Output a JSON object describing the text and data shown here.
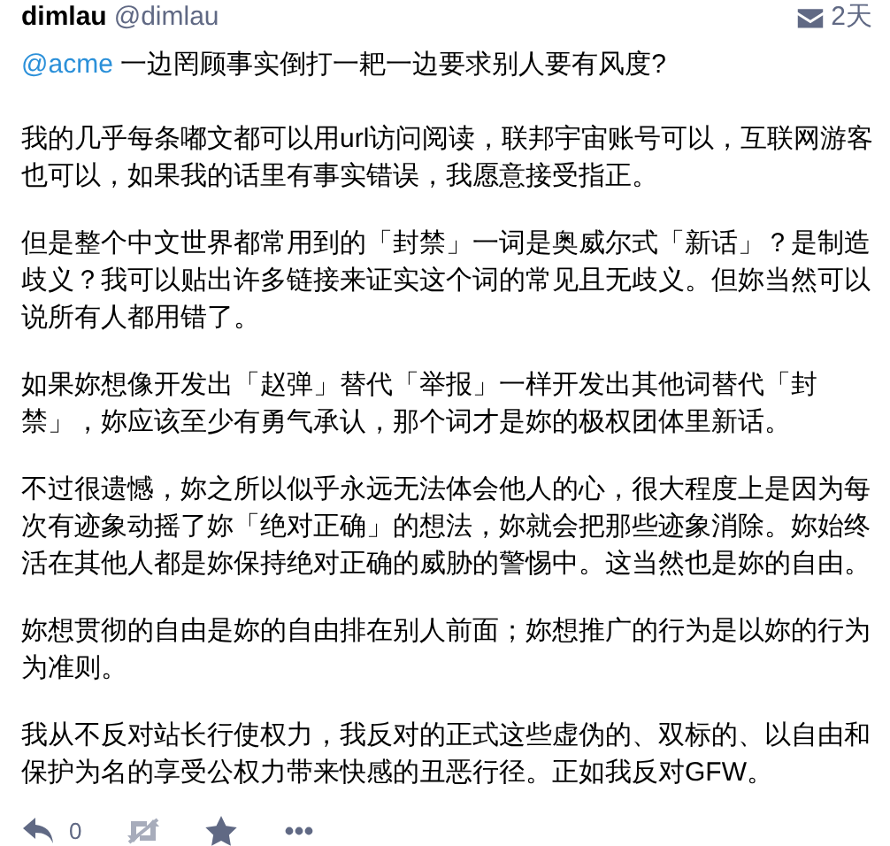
{
  "status": {
    "display_name": "dimlau",
    "handle": "@dimlau",
    "time": "2天",
    "mention": "@acme",
    "paragraphs": [
      "一边罔顾事实倒打一耙一边要求别人要有风度?",
      "我的几乎每条嘟文都可以用url访问阅读，联邦宇宙账号可以，互联网游客也可以，如果我的话里有事实错误，我愿意接受指正。",
      "但是整个中文世界都常用到的「封禁」一词是奥威尔式「新话」？是制造歧义？我可以贴出许多链接来证实这个词的常见且无歧义。但妳当然可以说所有人都用错了。",
      "如果妳想像开发出「赵弹」替代「举报」一样开发出其他词替代「封禁」，妳应该至少有勇气承认，那个词才是妳的极权团体里新话。",
      "不过很遗憾，妳之所以似乎永远无法体会他人的心，很大程度上是因为每次有迹象动摇了妳「绝对正确」的想法，妳就会把那些迹象消除。妳始终活在其他人都是妳保持绝对正确的威胁的警惕中。这当然也是妳的自由。",
      "妳想贯彻的自由是妳的自由排在别人前面；妳想推广的行为是以妳的行为为准则。",
      "我从不反对站长行使权力，我反对的正式这些虚伪的、双标的、以自由和保护为名的享受公权力带来快感的丑恶行径。正如我反对GFW。"
    ]
  },
  "actions": {
    "reply_count": "0",
    "boost_disabled": true
  }
}
